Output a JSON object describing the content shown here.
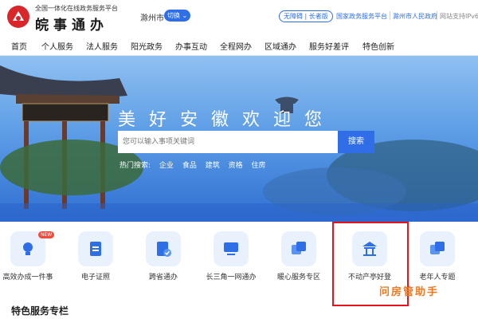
{
  "header": {
    "slogan": "全国一体化在线政务服务平台",
    "brand": "皖事通办",
    "city": "滁州市",
    "switch_label": "切换",
    "accessibility": "无障碍 | 长者版",
    "links": [
      "国家政务服务平台",
      "滁州市人民政府",
      "网站支持IPv6"
    ]
  },
  "nav": {
    "items": [
      "首页",
      "个人服务",
      "法人服务",
      "阳光政务",
      "办事互动",
      "全程网办",
      "区域通办",
      "服务好差评",
      "特色创新"
    ]
  },
  "banner": {
    "title": "美好安徽欢迎您",
    "search_placeholder": "您可以输入事项关键词",
    "search_button": "搜索",
    "hot_label": "热门搜索:",
    "hot_terms": [
      "企业",
      "食品",
      "建筑",
      "资格",
      "住房"
    ]
  },
  "services": [
    {
      "label": "高效办成一件事",
      "icon": "bulb-icon",
      "badge": "NEW"
    },
    {
      "label": "电子证照",
      "icon": "document-icon"
    },
    {
      "label": "跨省通办",
      "icon": "form-check-icon"
    },
    {
      "label": "长三角一网通办",
      "icon": "monitor-icon"
    },
    {
      "label": "暖心服务专区",
      "icon": "tiles-icon"
    },
    {
      "label": "不动产亭好登",
      "icon": "pavilion-icon"
    },
    {
      "label": "老年人专题",
      "icon": "tiles-icon"
    }
  ],
  "watermark": "问房管助手",
  "section": {
    "title": "特色服务专栏"
  },
  "colors": {
    "primary": "#2e6ee6",
    "logo_red": "#d9262b",
    "highlight_box": "#e3141a",
    "watermark": "#f07a22"
  }
}
